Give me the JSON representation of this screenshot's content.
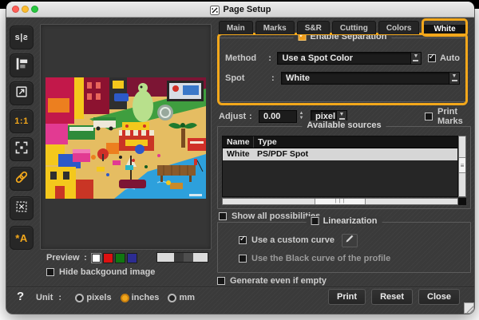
{
  "window": {
    "title": "Page Setup"
  },
  "punct": {
    "colon": ":",
    "check": "✓",
    "arrow": "▼",
    "spin_up": "▲",
    "spin_down": "▼",
    "grip_v": "≡",
    "grip_h": "| | |"
  },
  "sidebar": {
    "mirror": "s|ƨ",
    "zoom_1_1": "1:1",
    "annotate": "*A"
  },
  "preview": {
    "label": "Preview",
    "hide_background_label": "Hide backgound image",
    "swatches": [
      "#ffffff",
      "#dd1111",
      "#117711",
      "#2c2c92"
    ],
    "strip_colors": [
      "#dcdcdc",
      "#3a3a3a",
      "#4e4e4e",
      "#dcdcdc"
    ]
  },
  "tabs": {
    "items": [
      "Main",
      "Marks",
      "S&R",
      "Cutting",
      "Colors",
      "White"
    ],
    "active": "White"
  },
  "separation": {
    "legend": "Enable Separation",
    "enabled": true,
    "method_label": "Method",
    "method_value": "Use a Spot Color",
    "auto_label": "Auto",
    "auto_checked": true,
    "spot_label": "Spot",
    "spot_value": "White"
  },
  "adjust": {
    "label": "Adjust",
    "value": "0.00",
    "unit": "pixel",
    "print_marks_label": "Print Marks",
    "print_marks_checked": false
  },
  "sources": {
    "legend": "Available sources",
    "columns": [
      "Name",
      "Type"
    ],
    "rows": [
      {
        "name": "White",
        "type": "PS/PDF Spot"
      }
    ],
    "show_all_label": "Show all possibilities",
    "show_all_checked": false
  },
  "linearization": {
    "legend": "Linearization",
    "enabled": false,
    "custom_curve_label": "Use a custom curve",
    "custom_curve_checked": true,
    "black_curve_label": "Use the Black curve of the profile",
    "black_curve_checked": false
  },
  "generate": {
    "label": "Generate even if empty",
    "checked": false
  },
  "footer": {
    "help": "?",
    "unit_label": "Unit",
    "units": [
      {
        "label": "pixels",
        "selected": false
      },
      {
        "label": "inches",
        "selected": true
      },
      {
        "label": "mm",
        "selected": false
      }
    ],
    "buttons": {
      "print": "Print",
      "reset": "Reset",
      "close": "Close"
    }
  },
  "colors": {
    "accent": "#f2a71b",
    "selection_row": "#d6d6d6"
  }
}
